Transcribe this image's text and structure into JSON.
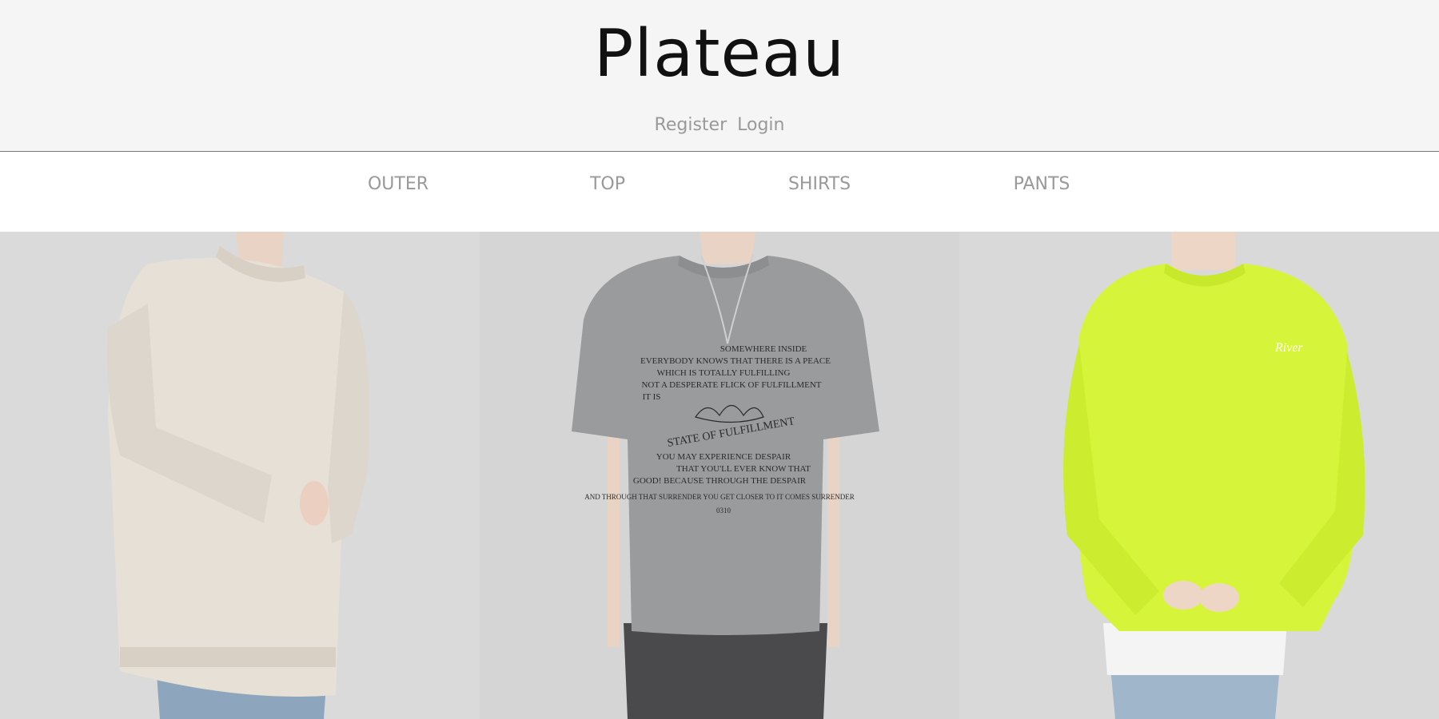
{
  "header": {
    "logo": "Plateau",
    "register_label": "Register",
    "login_label": "Login"
  },
  "nav": {
    "items": [
      {
        "label": "OUTER"
      },
      {
        "label": "TOP"
      },
      {
        "label": "SHIRTS"
      },
      {
        "label": "PANTS"
      }
    ]
  },
  "products": [
    {
      "name": "beige-knit-sweater",
      "color": "#e6e0d7"
    },
    {
      "name": "grey-graphic-tee",
      "color": "#9a9b9c",
      "print": {
        "line1": "SOMEWHERE INSIDE",
        "line2": "EVERYBODY KNOWS THAT THERE IS A PEACE",
        "line3": "WHICH IS TOTALLY FULFILLING",
        "line4": "NOT A DESPERATE FLICK OF FULFILLMENT",
        "line5": "IT IS",
        "line6": "STATE OF FULFILLMENT",
        "line7": "YOU MAY EXPERIENCE DESPAIR",
        "line8": "THAT YOU'LL EVER KNOW THAT",
        "line9": "GOOD! BECAUSE THROUGH THE DESPAIR",
        "line10": "AND THROUGH THAT SURRENDER YOU GET CLOSER TO IT COMES SURRENDER",
        "line11": "0310"
      }
    },
    {
      "name": "neon-green-sweatshirt",
      "color": "#d6f53a",
      "logo": "River"
    }
  ]
}
